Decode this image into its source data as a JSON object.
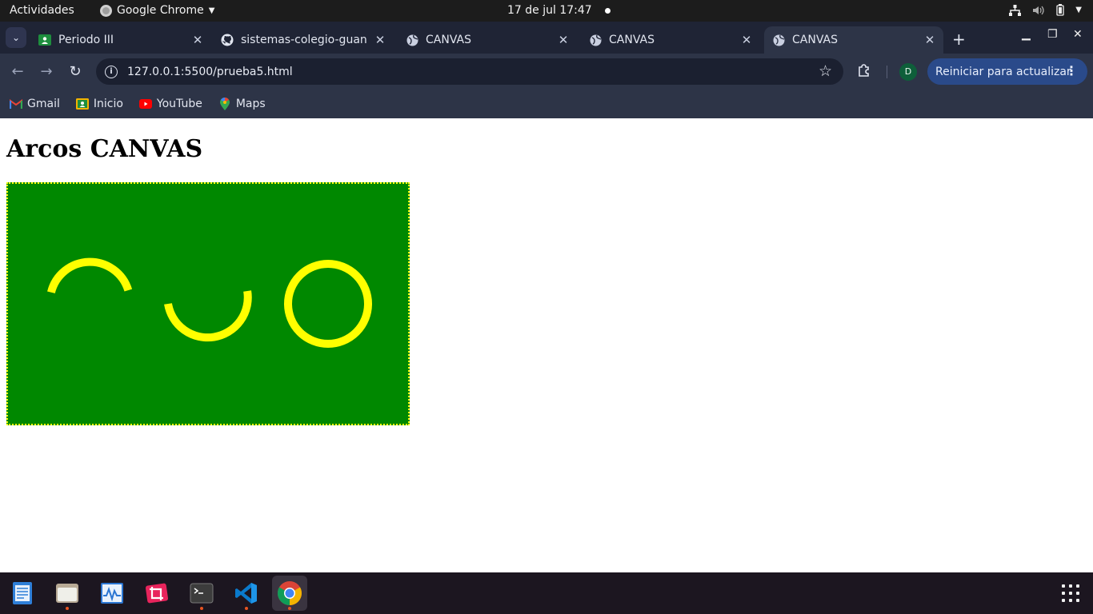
{
  "topbar": {
    "activities": "Actividades",
    "app_name": "Google Chrome",
    "datetime": "17 de jul  17:47"
  },
  "tabs": [
    {
      "title": "Periodo III",
      "icon": "classroom-icon",
      "active": false
    },
    {
      "title": "sistemas-colegio-guan",
      "icon": "github-icon",
      "active": false
    },
    {
      "title": "CANVAS",
      "icon": "globe-icon",
      "active": false
    },
    {
      "title": "CANVAS",
      "icon": "globe-icon",
      "active": false
    },
    {
      "title": "CANVAS",
      "icon": "globe-icon",
      "active": true
    }
  ],
  "toolbar": {
    "url": "127.0.0.1:5500/prueba5.html",
    "avatar_initial": "D",
    "update_label": "Reiniciar para actualizar"
  },
  "bookmarks": [
    {
      "label": "Gmail",
      "icon": "gmail-icon"
    },
    {
      "label": "Inicio",
      "icon": "classroom-icon"
    },
    {
      "label": "YouTube",
      "icon": "youtube-icon"
    },
    {
      "label": "Maps",
      "icon": "maps-icon"
    }
  ],
  "page": {
    "heading": "Arcos CANVAS",
    "canvas": {
      "background": "#008800",
      "stroke": "#ffff00",
      "shapes": [
        "upper-arc",
        "lower-arc",
        "full-circle"
      ]
    }
  },
  "dock": [
    {
      "name": "text-editor",
      "running": false
    },
    {
      "name": "files",
      "running": true
    },
    {
      "name": "system-monitor",
      "running": false
    },
    {
      "name": "screenshot-crop",
      "running": false
    },
    {
      "name": "terminal",
      "running": true
    },
    {
      "name": "vscode",
      "running": true
    },
    {
      "name": "chrome",
      "running": true
    }
  ]
}
